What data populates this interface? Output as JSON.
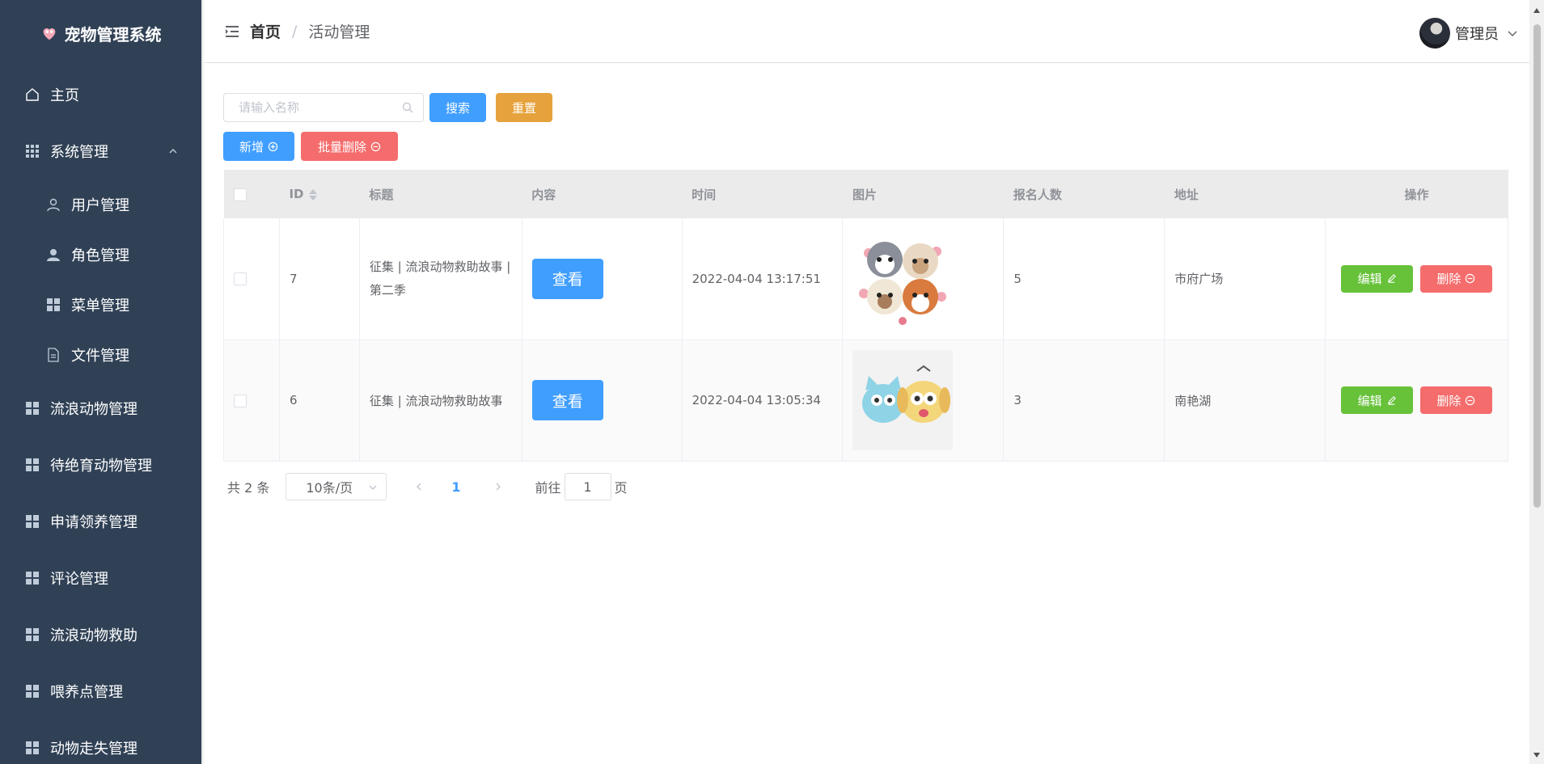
{
  "sidebar": {
    "title": "宠物管理系统",
    "items": [
      {
        "label": "主页"
      },
      {
        "label": "系统管理"
      },
      {
        "label": "用户管理"
      },
      {
        "label": "角色管理"
      },
      {
        "label": "菜单管理"
      },
      {
        "label": "文件管理"
      },
      {
        "label": "流浪动物管理"
      },
      {
        "label": "待绝育动物管理"
      },
      {
        "label": "申请领养管理"
      },
      {
        "label": "评论管理"
      },
      {
        "label": "流浪动物救助"
      },
      {
        "label": "喂养点管理"
      },
      {
        "label": "动物走失管理"
      }
    ]
  },
  "header": {
    "breadcrumb_home": "首页",
    "breadcrumb_sep": "/",
    "breadcrumb_current": "活动管理",
    "user_name": "管理员"
  },
  "toolbar": {
    "search_placeholder": "请输入名称",
    "search_label": "搜索",
    "reset_label": "重置",
    "add_label": "新增",
    "batch_delete_label": "批量删除"
  },
  "table": {
    "columns": [
      "ID",
      "标题",
      "内容",
      "时间",
      "图片",
      "报名人数",
      "地址",
      "操作"
    ],
    "rows": [
      {
        "id": "7",
        "title": "征集 | 流浪动物救助故事 | 第二季",
        "content_btn": "查看",
        "time": "2022-04-04 13:17:51",
        "count": "5",
        "address": "市府广场",
        "edit": "编辑",
        "delete": "删除"
      },
      {
        "id": "6",
        "title": "征集 | 流浪动物救助故事",
        "content_btn": "查看",
        "time": "2022-04-04 13:05:34",
        "count": "3",
        "address": "南艳湖",
        "edit": "编辑",
        "delete": "删除"
      }
    ]
  },
  "pager": {
    "total": "共 2 条",
    "page_size": "10条/页",
    "current_page": "1",
    "goto_label": "前往",
    "goto_value": "1",
    "page_suffix": "页"
  },
  "colors": {
    "sidebar_bg": "#304156",
    "primary": "#409eff",
    "warning": "#e6a23c",
    "danger": "#f56c6c",
    "success": "#67c23a"
  }
}
